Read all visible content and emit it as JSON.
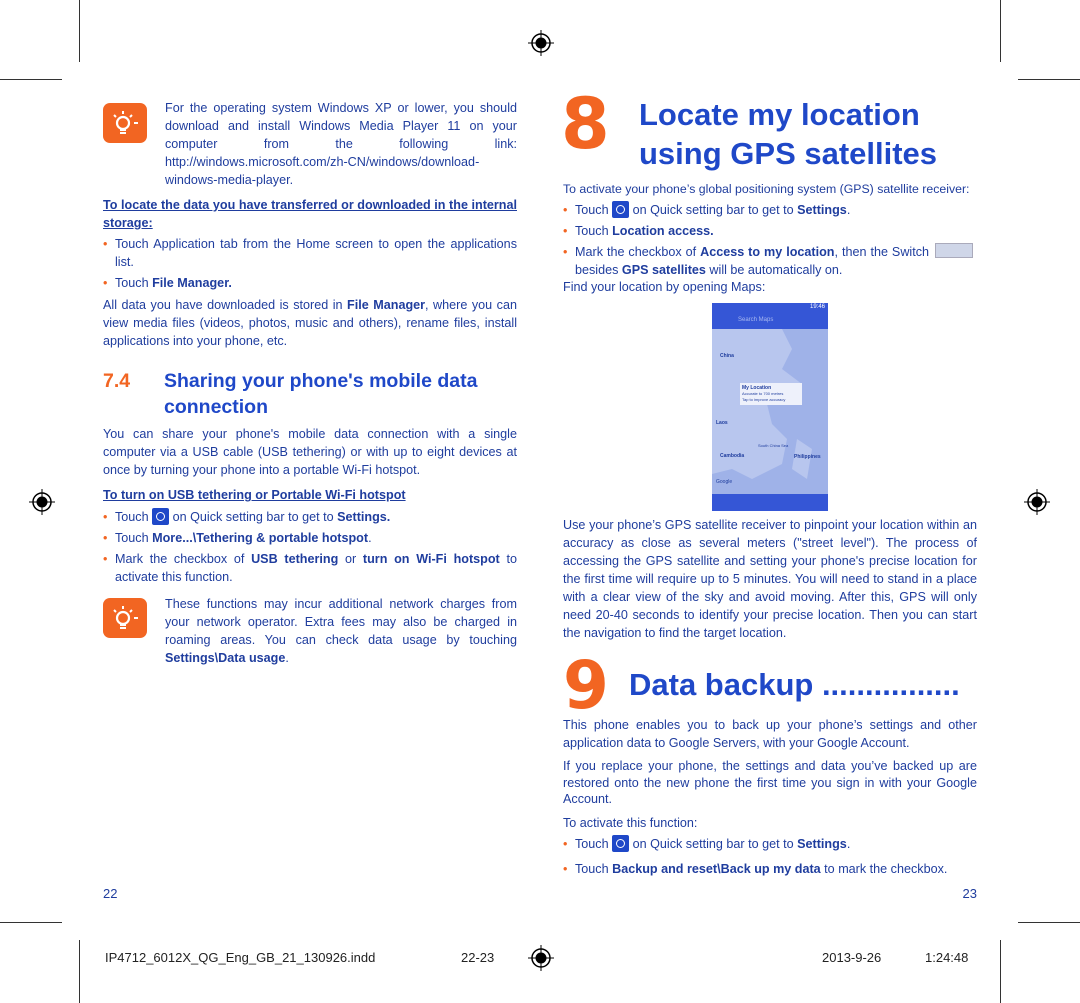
{
  "left": {
    "tip1": [
      {
        "t": "For the operating system Windows XP or lower, you should download and install Windows Media Player 11 on your computer from the following link: http://windows.microsoft.com/zh-CN/windows/download-windows-media-player."
      }
    ],
    "locate_heading": "To locate the data you have transferred or downloaded in the internal storage:",
    "locate_bullets": [
      [
        {
          "t": "Touch Application tab from the Home screen to open the applications list."
        }
      ],
      [
        {
          "t": "Touch "
        },
        {
          "t": "File Manager.",
          "b": true
        }
      ]
    ],
    "locate_para": [
      {
        "t": "All data you have downloaded is stored in "
      },
      {
        "t": "File Manager",
        "b": true
      },
      {
        "t": ", where you can view media files (videos, photos, music and others), rename files, install applications into your phone, etc."
      }
    ],
    "section_number": "7.4",
    "section_title": "Sharing your phone's mobile data connection",
    "section_para": [
      {
        "t": "You can share your phone's mobile data connection with a single computer via a USB cable (USB tethering) or with up to eight devices at once by turning your phone into a portable Wi-Fi hotspot."
      }
    ],
    "tether_heading": "To turn on USB tethering or Portable Wi-Fi hotspot",
    "tether_bullets": [
      [
        {
          "t": "Touch "
        },
        {
          "icon": "gear"
        },
        {
          "t": " on Quick setting bar to get to "
        },
        {
          "t": "Settings.",
          "b": true
        }
      ],
      [
        {
          "t": "Touch "
        },
        {
          "t": "More...\\Tethering & portable hotspot",
          "b": true
        },
        {
          "t": "."
        }
      ],
      [
        {
          "t": "Mark the checkbox of "
        },
        {
          "t": "USB tethering",
          "b": true
        },
        {
          "t": " or "
        },
        {
          "t": "turn on Wi-Fi hotspot",
          "b": true
        },
        {
          "t": " to activate this function."
        }
      ]
    ],
    "tip2": [
      {
        "t": "These functions may incur additional network charges from your network operator. Extra fees may also be charged in roaming areas. You can check data usage by touching "
      },
      {
        "t": "Settings\\Data usage",
        "b": true
      },
      {
        "t": "."
      }
    ],
    "page_number": "22"
  },
  "right": {
    "chapter8_number": "8",
    "chapter8_title": "Locate my location using GPS satellites",
    "gps_intro": [
      {
        "t": "To activate your phone’s global positioning system (GPS) satellite receiver:"
      }
    ],
    "gps_bullets": [
      [
        {
          "t": "Touch "
        },
        {
          "icon": "gear"
        },
        {
          "t": " on Quick setting bar to get to "
        },
        {
          "t": "Settings",
          "b": true
        },
        {
          "t": "."
        }
      ],
      [
        {
          "t": "Touch "
        },
        {
          "t": "Location access.",
          "b": true
        }
      ],
      [
        {
          "t": "Mark the checkbox of "
        },
        {
          "t": "Access to my location",
          "b": true
        },
        {
          "t": ", then the Switch "
        },
        {
          "icon": "switch"
        },
        {
          "t": " besides "
        },
        {
          "t": "GPS satellites",
          "b": true
        },
        {
          "t": " will be automatically on."
        }
      ]
    ],
    "find_text": [
      {
        "t": "Find your location by opening Maps:"
      }
    ],
    "map_screenshot": {
      "time": "19:46",
      "search_placeholder": "Search Maps",
      "popup_title": "My Location",
      "popup_line1": "Accurate to 700 metres",
      "popup_line2": "Tap to improve accuracy",
      "labels": [
        "China",
        "Laos",
        "Cambodia",
        "Philippines",
        "South China Sea",
        "Google"
      ]
    },
    "gps_para": [
      {
        "t": "Use your phone’s GPS satellite receiver to pinpoint your location within an accuracy as close as several meters (\"street level\"). The process of accessing the GPS satellite and setting your phone's precise location for the first time will require up to 5 minutes. You will need to stand in a place with a clear view of the sky and avoid moving. After this, GPS will only need 20-40 seconds to identify your precise location. Then you can start the navigation to find the target location."
      }
    ],
    "chapter9_number": "9",
    "chapter9_title": "Data backup ................",
    "backup_para1": [
      {
        "t": "This phone enables you to back up your phone’s settings and other application data to Google Servers, with your Google Account."
      }
    ],
    "backup_para2": [
      {
        "t": "If you replace your phone, the settings and data you’ve backed up are restored onto the new phone the first time you sign in with your Google Account."
      }
    ],
    "backup_para3": [
      {
        "t": "To activate this function:"
      }
    ],
    "backup_bullets": [
      [
        {
          "t": "Touch "
        },
        {
          "icon": "gear"
        },
        {
          "t": " on Quick setting bar to get to "
        },
        {
          "t": "Settings",
          "b": true
        },
        {
          "t": "."
        }
      ],
      [
        {
          "t": "Touch "
        },
        {
          "t": "Backup and reset\\Back up my data",
          "b": true
        },
        {
          "t": " to mark the checkbox."
        }
      ]
    ],
    "page_number": "23"
  },
  "footer": {
    "filename": "IP4712_6012X_QG_Eng_GB_21_130926.indd",
    "pages": "22-23",
    "date": "2013-9-26",
    "time": "1:24:48"
  },
  "colors": {
    "text": "#1f3d9e",
    "heading": "#1f48c8",
    "accent": "#f26522"
  }
}
